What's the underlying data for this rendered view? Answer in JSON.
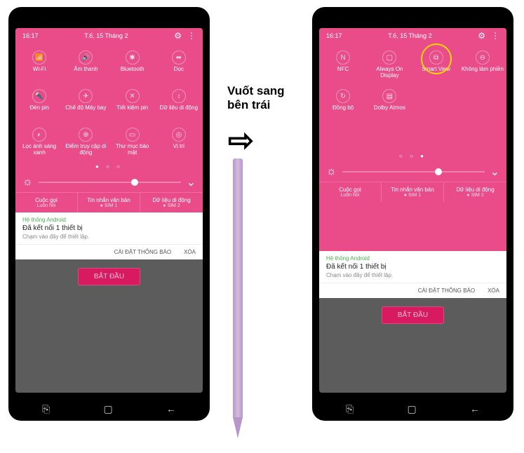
{
  "instruction": {
    "line1": "Vuốt sang",
    "line2": "bên trái"
  },
  "left": {
    "time": "16:17",
    "date": "T.6, 15 Tháng 2",
    "tiles": [
      {
        "icon": "📶",
        "label": "Wi-Fi"
      },
      {
        "icon": "🔊",
        "label": "Âm thanh"
      },
      {
        "icon": "✱",
        "label": "Bluetooth"
      },
      {
        "icon": "⬌",
        "label": "Dọc"
      },
      {
        "icon": "🔦",
        "label": "Đèn pin"
      },
      {
        "icon": "✈",
        "label": "Chế độ Máy bay"
      },
      {
        "icon": "✕",
        "label": "Tiết kiệm pin"
      },
      {
        "icon": "↕",
        "label": "Dữ liệu di động"
      },
      {
        "icon": "◐",
        "label": "Lọc ánh sáng xanh"
      },
      {
        "icon": "⊕",
        "label": "Điểm truy cập di động"
      },
      {
        "icon": "▭",
        "label": "Thư mục bảo mật"
      },
      {
        "icon": "◎",
        "label": "Vị trí"
      }
    ],
    "bottom": [
      {
        "title": "Cuộc gọi",
        "sub": "Luôn hỏi"
      },
      {
        "title": "Tin nhắn văn bản",
        "sub": "● SIM 1"
      },
      {
        "title": "Dữ liệu di động",
        "sub": "● SIM 2"
      }
    ],
    "notif": {
      "app": "Hệ thống Android",
      "title": "Đã kết nối 1 thiết bị",
      "sub": "Chạm vào đây để thiết lập."
    },
    "actions": {
      "settings": "CÀI ĐẶT THÔNG BÁO",
      "clear": "XÓA"
    },
    "start": "BẮT ĐẦU"
  },
  "right": {
    "time": "16:17",
    "date": "T.6, 15 Tháng 2",
    "tiles": [
      {
        "icon": "N",
        "label": "NFC"
      },
      {
        "icon": "▢",
        "label": "Always On Display"
      },
      {
        "icon": "⧉",
        "label": "Smart View",
        "highlight": true
      },
      {
        "icon": "⊖",
        "label": "Không làm phiền"
      },
      {
        "icon": "↻",
        "label": "Đồng bộ"
      },
      {
        "icon": "▤",
        "label": "Dolby Atmos"
      }
    ],
    "bottom": [
      {
        "title": "Cuộc gọi",
        "sub": "Luôn hỏi"
      },
      {
        "title": "Tin nhắn văn bản",
        "sub": "● SIM 1"
      },
      {
        "title": "Dữ liệu di động",
        "sub": "● SIM 2"
      }
    ],
    "notif": {
      "app": "Hệ thống Android",
      "title": "Đã kết nối 1 thiết bị",
      "sub": "Chạm vào đây để thiết lập."
    },
    "actions": {
      "settings": "CÀI ĐẶT THÔNG BÁO",
      "clear": "XÓA"
    },
    "start": "BẮT ĐẦU"
  }
}
